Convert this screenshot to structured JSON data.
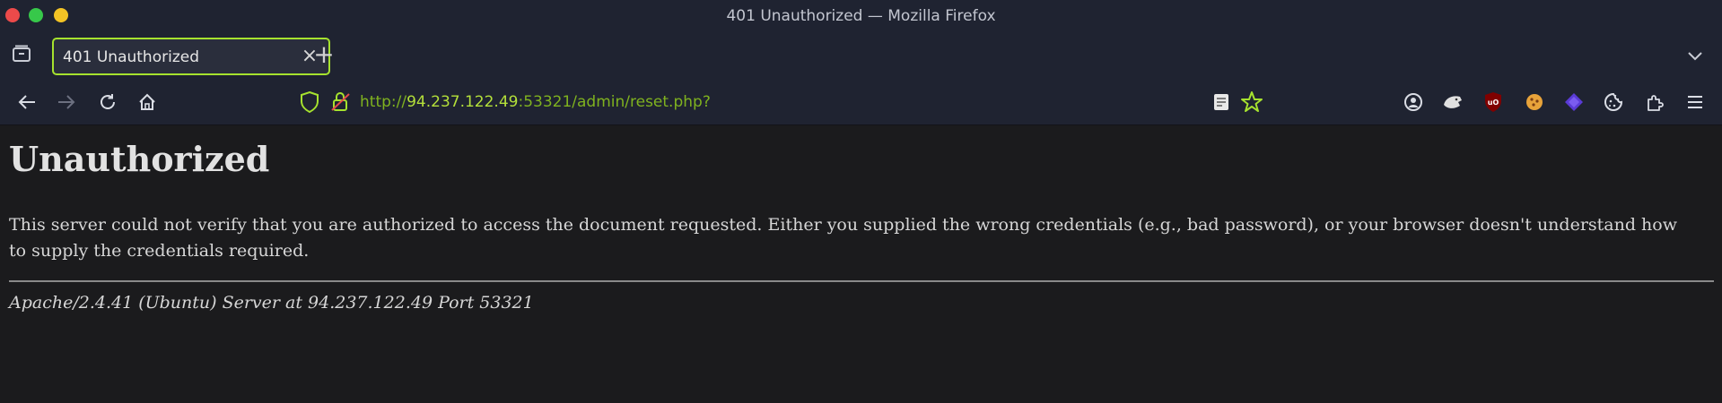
{
  "window": {
    "title": "401 Unauthorized — Mozilla Firefox"
  },
  "tabs": [
    {
      "label": "401 Unauthorized",
      "active": true
    }
  ],
  "toolbar": {
    "new_tab_symbol": "+",
    "close_symbol": "×",
    "url_prefix": "http://",
    "url_host": "94.237.122.49",
    "url_rest": ":53321/admin/reset.php?"
  },
  "page": {
    "heading": "Unauthorized",
    "body": "This server could not verify that you are authorized to access the document requested. Either you supplied the wrong credentials (e.g., bad password), or your browser doesn't understand how to supply the credentials required.",
    "signature": "Apache/2.4.41 (Ubuntu) Server at 94.237.122.49 Port 53321"
  },
  "colors": {
    "accent": "#a6e22e",
    "url_path": "#7fb21f",
    "url_host": "#b4e03a",
    "chrome_bg": "#1f2331",
    "page_bg": "#1b1b1d"
  },
  "icons": [
    "tab-overview-icon",
    "close-icon",
    "plus-icon",
    "chevron-down-icon",
    "back-arrow-icon",
    "forward-arrow-icon",
    "reload-icon",
    "home-icon",
    "shield-icon",
    "lock-icon",
    "reader-view-icon",
    "bookmark-star-icon",
    "account-icon",
    "extension-fox-icon",
    "ublock-origin-icon",
    "cookie-extension-icon",
    "diamond-extension-icon",
    "cookie-icon",
    "extensions-puzzle-icon",
    "hamburger-menu-icon"
  ]
}
